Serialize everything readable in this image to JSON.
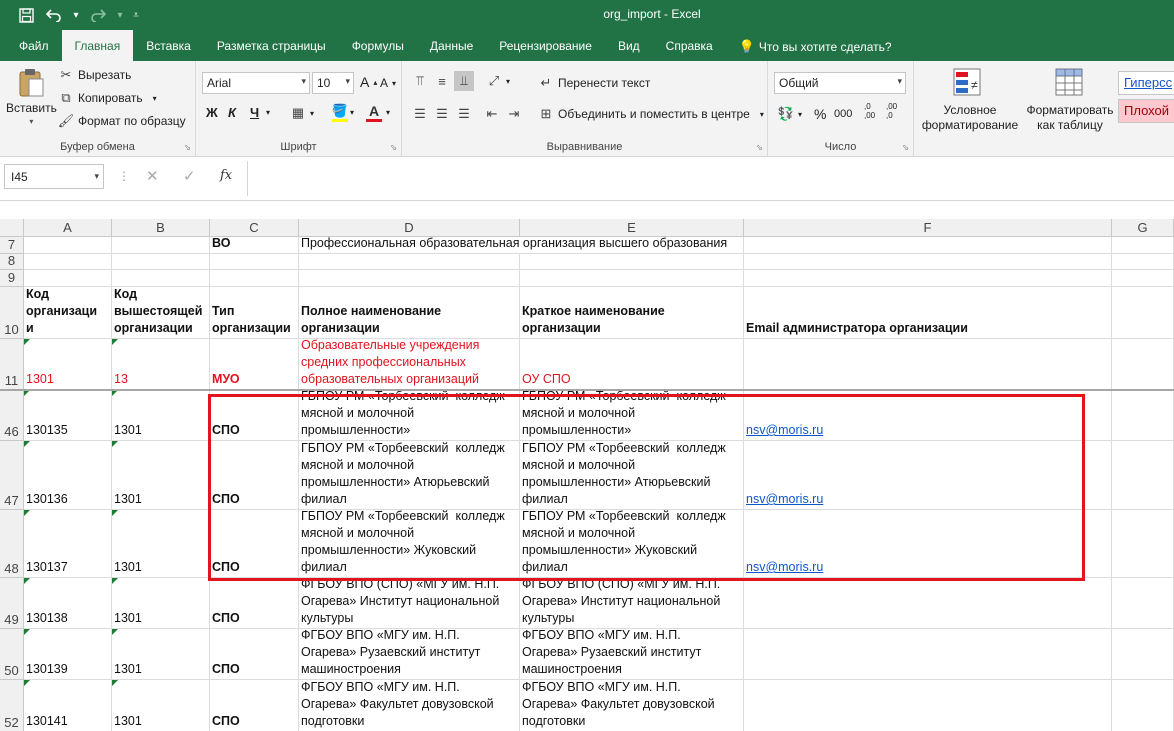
{
  "window": {
    "title": "org_import  -  Excel"
  },
  "qat": {
    "save_icon": "save-icon",
    "undo_icon": "undo-icon",
    "redo_icon": "redo-icon",
    "customize_icon": "customize-icon"
  },
  "tabs": [
    {
      "label": "Файл"
    },
    {
      "label": "Главная"
    },
    {
      "label": "Вставка"
    },
    {
      "label": "Разметка страницы"
    },
    {
      "label": "Формулы"
    },
    {
      "label": "Данные"
    },
    {
      "label": "Рецензирование"
    },
    {
      "label": "Вид"
    },
    {
      "label": "Справка"
    },
    {
      "label": "Что вы хотите сделать?"
    }
  ],
  "ribbon": {
    "clipboard": {
      "paste": "Вставить",
      "cut": "Вырезать",
      "copy": "Копировать",
      "format_painter": "Формат по образцу",
      "label": "Буфер обмена"
    },
    "font": {
      "name": "Arial",
      "size": "10",
      "bold": "Ж",
      "italic": "К",
      "underline": "Ч",
      "label": "Шрифт",
      "fill_color": "#ffff00",
      "font_color": "#e0141e"
    },
    "alignment": {
      "wrap": "Перенести текст",
      "merge": "Объединить и поместить в центре",
      "label": "Выравнивание"
    },
    "number": {
      "format": "Общий",
      "percent": "%",
      "thousands": "000",
      "inc_dec": ",0\n,00",
      "dec_dec": ",00\n,0",
      "label": "Число"
    },
    "styles": {
      "conditional": "Условное\nформатирование",
      "as_table": "Форматировать\nкак таблицу",
      "hyperlink": "Гиперсс",
      "bad": "Плохой"
    }
  },
  "formula_bar": {
    "name_box": "I45",
    "cancel": "✕",
    "enter": "✓",
    "fx": "fx",
    "value": ""
  },
  "columns": [
    "A",
    "B",
    "C",
    "D",
    "E",
    "F",
    "G"
  ],
  "rows": [
    {
      "num": "7",
      "cells": [
        "",
        "",
        "ВО",
        "Профессиональная образовательная организация высшего образования",
        "",
        "",
        ""
      ]
    },
    {
      "num": "8",
      "cells": [
        "",
        "",
        "",
        "",
        "",
        "",
        ""
      ]
    },
    {
      "num": "9",
      "cells": [
        "",
        "",
        "",
        "",
        "",
        "",
        ""
      ]
    },
    {
      "num": "10",
      "cells": [
        "Код\nорганизаци\nи",
        "Код\nвышестоящей\nорганизации",
        "Тип\nорганизации",
        "Полное наименование\nорганизации",
        "Краткое наименование\nорганизации",
        "Email администратора организации",
        ""
      ]
    },
    {
      "num": "11",
      "cells": [
        "1301",
        "13",
        "МУО",
        "Образовательные учреждения\nсредних профессиональных\nобразовательных организаций",
        "ОУ СПО",
        "",
        ""
      ]
    },
    {
      "num": "46",
      "cells": [
        "130135",
        "1301",
        "СПО",
        "ГБПОУ РМ «Торбеевский  колледж\nмясной и молочной\nпромышленности»",
        "ГБПОУ РМ «Торбеевский  колледж\nмясной и молочной\nпромышленности»",
        "nsv@moris.ru",
        ""
      ]
    },
    {
      "num": "47",
      "cells": [
        "130136",
        "1301",
        "СПО",
        "ГБПОУ РМ «Торбеевский  колледж\nмясной и молочной\nпромышленности» Атюрьевский\nфилиал",
        "ГБПОУ РМ «Торбеевский  колледж\nмясной и молочной\nпромышленности» Атюрьевский\nфилиал",
        "nsv@moris.ru",
        ""
      ]
    },
    {
      "num": "48",
      "cells": [
        "130137",
        "1301",
        "СПО",
        "ГБПОУ РМ «Торбеевский  колледж\nмясной и молочной\nпромышленности» Жуковский\nфилиал",
        "ГБПОУ РМ «Торбеевский  колледж\nмясной и молочной\nпромышленности» Жуковский\nфилиал",
        "nsv@moris.ru",
        ""
      ]
    },
    {
      "num": "49",
      "cells": [
        "130138",
        "1301",
        "СПО",
        "ФГБОУ ВПО (СПО) «МГУ им. Н.П.\nОгарева» Институт национальной\nкультуры",
        "ФГБОУ ВПО (СПО) «МГУ им. Н.П.\nОгарева» Институт национальной\nкультуры",
        "",
        ""
      ]
    },
    {
      "num": "50",
      "cells": [
        "130139",
        "1301",
        "СПО",
        "ФГБОУ ВПО «МГУ им. Н.П.\nОгарева» Рузаевский институт\nмашиностроения",
        "ФГБОУ ВПО «МГУ им. Н.П.\nОгарева» Рузаевский институт\nмашиностроения",
        "",
        ""
      ]
    },
    {
      "num": "52",
      "cells": [
        "130141",
        "1301",
        "СПО",
        "ФГБОУ ВПО «МГУ им. Н.П.\nОгарева» Факультет довузовской\nподготовки",
        "ФГБОУ ВПО «МГУ им. Н.П.\nОгарева» Факультет довузовской\nподготовки",
        "",
        ""
      ]
    }
  ]
}
